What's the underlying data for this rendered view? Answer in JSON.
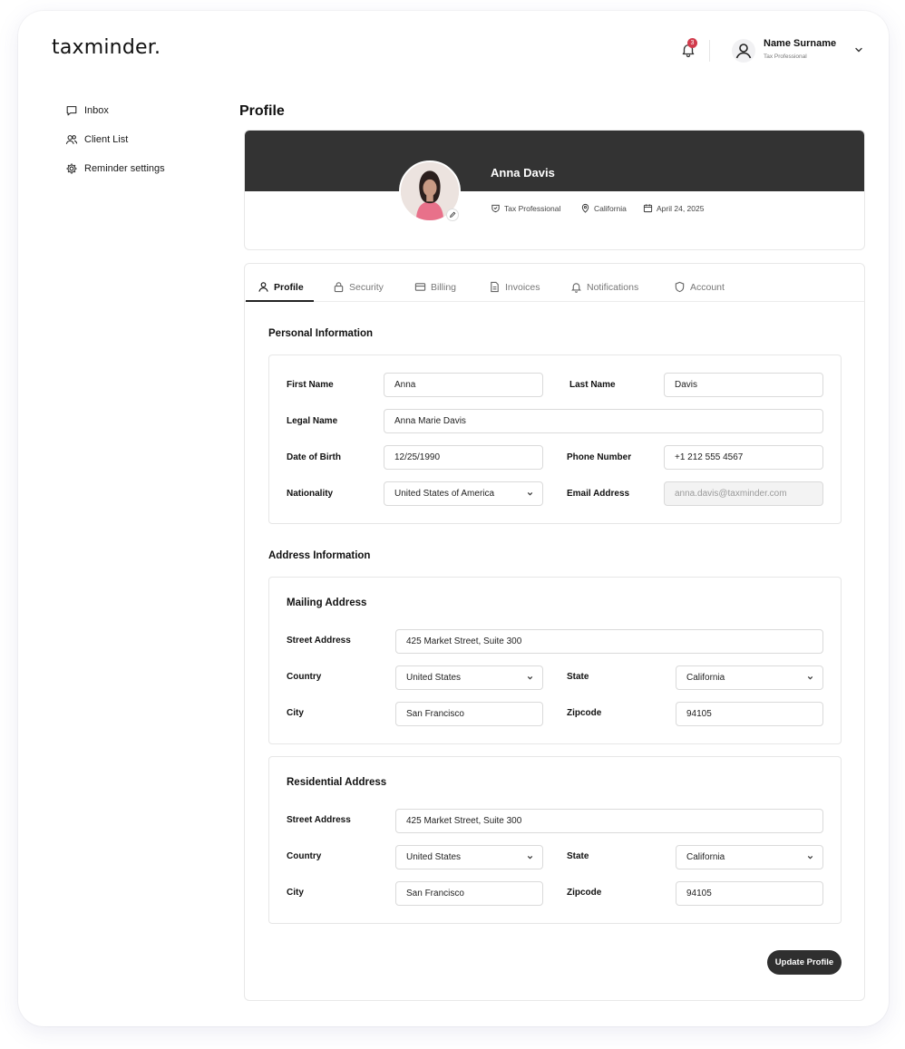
{
  "app": {
    "logo": "taxminder."
  },
  "header": {
    "notification_count": "3",
    "user_name": "Name Surname",
    "user_role": "Tax Professional"
  },
  "sidebar": {
    "items": [
      {
        "label": "Inbox",
        "icon": "message-icon"
      },
      {
        "label": "Client List",
        "icon": "users-icon"
      },
      {
        "label": "Reminder settings",
        "icon": "gear-icon"
      }
    ]
  },
  "page": {
    "title": "Profile"
  },
  "profile": {
    "name": "Anna Davis",
    "role": "Tax Professional",
    "location": "California",
    "date": "April 24, 2025"
  },
  "tabs": [
    {
      "label": "Profile",
      "icon": "user-icon",
      "active": true
    },
    {
      "label": "Security",
      "icon": "lock-icon",
      "active": false
    },
    {
      "label": "Billing",
      "icon": "credit-card-icon",
      "active": false
    },
    {
      "label": "Invoices",
      "icon": "document-icon",
      "active": false
    },
    {
      "label": "Notifications",
      "icon": "bell-icon",
      "active": false
    },
    {
      "label": "Account",
      "icon": "shield-icon",
      "active": false
    }
  ],
  "personal": {
    "title": "Personal Information",
    "first_name_label": "First Name",
    "first_name": "Anna",
    "last_name_label": "Last Name",
    "last_name": "Davis",
    "legal_name_label": "Legal Name",
    "legal_name": "Anna Marie Davis",
    "dob_label": "Date of Birth",
    "dob": "12/25/1990",
    "phone_label": "Phone Number",
    "phone": "+1 212 555 4567",
    "nationality_label": "Nationality",
    "nationality": "United States of America",
    "email_label": "Email Address",
    "email": "anna.davis@taxminder.com"
  },
  "address": {
    "title": "Address Information",
    "mailing": {
      "title": "Mailing Address",
      "street_label": "Street Address",
      "street": "425 Market Street, Suite 300",
      "country_label": "Country",
      "country": "United States",
      "state_label": "State",
      "state": "California",
      "city_label": "City",
      "city": "San Francisco",
      "zip_label": "Zipcode",
      "zip": "94105"
    },
    "residential": {
      "title": "Residential Address",
      "street_label": "Street Address",
      "street": "425 Market Street, Suite 300",
      "country_label": "Country",
      "country": "United States",
      "state_label": "State",
      "state": "California",
      "city_label": "City",
      "city": "San Francisco",
      "zip_label": "Zipcode",
      "zip": "94105"
    }
  },
  "actions": {
    "update_label": "Update Profile"
  },
  "colors": {
    "banner": "#333333",
    "badge": "#d13b4c",
    "button": "#2f2f2f"
  }
}
